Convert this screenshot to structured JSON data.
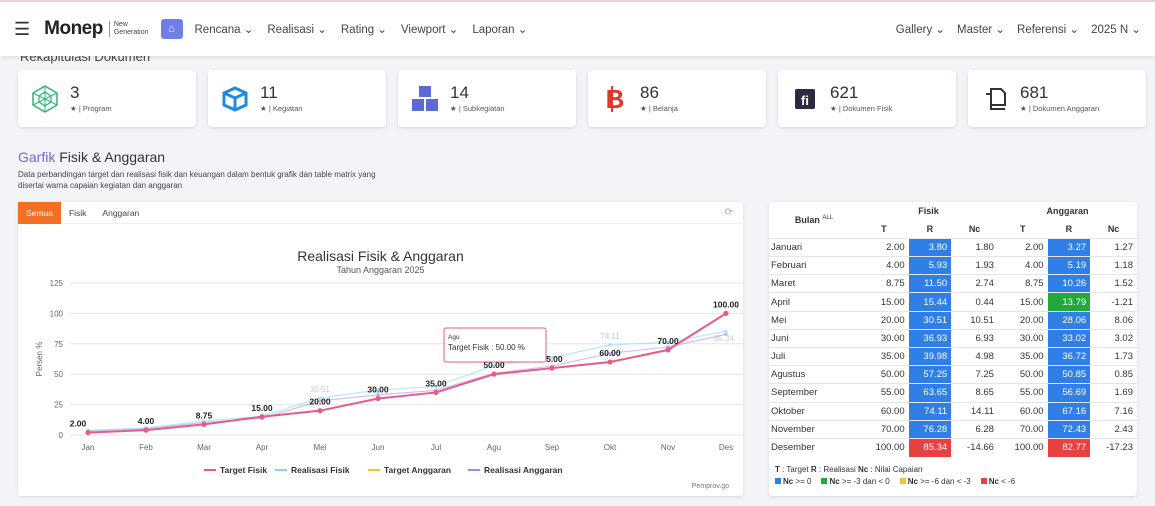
{
  "nav": {
    "logo": "Monep",
    "logo_sub_1": "New",
    "logo_sub_2": "Generation",
    "menu": [
      "Rencana ⌄",
      "Realisasi ⌄",
      "Rating ⌄",
      "Viewport ⌄",
      "Laporan ⌄"
    ],
    "right": [
      "Gallery ⌄",
      "Master ⌄",
      "Referensi ⌄",
      "2025 N ⌄"
    ]
  },
  "hidden_title": "Rekapitulasi Dokumen",
  "cards": [
    {
      "icon": "hexagon-network-icon",
      "value": "3",
      "label": "| Program"
    },
    {
      "icon": "cube-icon",
      "value": "11",
      "label": "| Kegiatan"
    },
    {
      "icon": "cubes-icon",
      "value": "14",
      "label": "| Subkegiatan"
    },
    {
      "icon": "bitcoin-icon",
      "value": "86",
      "label": "| Belanja"
    },
    {
      "icon": "fi-document-icon",
      "value": "621",
      "label": "| Dokumen Fisik"
    },
    {
      "icon": "copy-document-icon",
      "value": "681",
      "label": "| Dokumen Anggaran"
    }
  ],
  "section": {
    "title_colored": "Garfik",
    "title_rest": " Fisik & Anggaran",
    "desc": "Data perbandingan target dan realisasi fisik dan keuangan dalam bentuk grafik dan table matrix yang disertai warna capaian kegiatan dan anggaran"
  },
  "tabs": [
    "Semua",
    "Fisik",
    "Anggaran"
  ],
  "credit": "Pemprov.go",
  "tooltip": {
    "title": "Agu",
    "text": "Target Fisik : 50.00 %"
  },
  "colors": {
    "target_fisik": "#e85a8a",
    "realisasi_fisik": "#7fd8ec",
    "target_anggaran": "#f2c23b",
    "realisasi_anggaran": "#a98ae8",
    "blue": "#2f7fe6",
    "green": "#22a83b",
    "yellow": "#f2c23b",
    "red": "#e84141"
  },
  "chart_data": {
    "type": "line",
    "title": "Realisasi Fisik & Anggaran",
    "subtitle": "Tahun Anggaran 2025",
    "ylabel": "Persen %",
    "ylim": [
      0,
      125
    ],
    "yticks": [
      0,
      25,
      50,
      75,
      100,
      125
    ],
    "categories": [
      "Jan",
      "Feb",
      "Mar",
      "Apr",
      "Mei",
      "Jun",
      "Jul",
      "Agu",
      "Sep",
      "Okt",
      "Nov",
      "Des"
    ],
    "series": [
      {
        "name": "Target Fisik",
        "values": [
          2.0,
          4.0,
          8.75,
          15.0,
          20.0,
          30.0,
          35.0,
          50.0,
          55.0,
          60.0,
          70.0,
          100.0
        ]
      },
      {
        "name": "Realisasi Fisik",
        "values": [
          3.8,
          5.93,
          11.5,
          15.44,
          30.51,
          36.93,
          39.98,
          57.25,
          63.65,
          74.11,
          76.28,
          85.34
        ]
      },
      {
        "name": "Target Anggaran",
        "values": [
          2.0,
          4.0,
          8.75,
          15.0,
          20.0,
          30.0,
          35.0,
          50.0,
          55.0,
          60.0,
          70.0,
          100.0
        ]
      },
      {
        "name": "Realisasi Anggaran",
        "values": [
          3.27,
          5.19,
          10.26,
          13.79,
          28.06,
          33.02,
          36.72,
          50.85,
          56.69,
          67.16,
          72.43,
          82.77
        ]
      }
    ],
    "shown_labels": {
      "target_fisik": [
        "2.00",
        "4.00",
        "8.75",
        "15.00",
        "20.00",
        "30.00",
        "35.00",
        "50.00",
        "55.00",
        "60.00",
        "70.00",
        "100.00"
      ],
      "realisasi_faded": [
        {
          "i": 4,
          "t": "30.51"
        },
        {
          "i": 9,
          "t": "74.11"
        },
        {
          "i": 11,
          "t": "85.34"
        }
      ]
    }
  },
  "table": {
    "bulan": "Bulan",
    "all": "ALL",
    "fisik": "Fisik",
    "anggaran": "Anggaran",
    "cols": [
      "T",
      "R",
      "Nc",
      "T",
      "R",
      "Nc"
    ],
    "rows": [
      [
        "Januari",
        "2.00",
        "3.80",
        "1.80",
        "2.00",
        "3.27",
        "1.27",
        "b"
      ],
      [
        "Februari",
        "4.00",
        "5.93",
        "1.93",
        "4.00",
        "5.19",
        "1.18",
        "b"
      ],
      [
        "Maret",
        "8.75",
        "11.50",
        "2.74",
        "8.75",
        "10.26",
        "1.52",
        "b"
      ],
      [
        "April",
        "15.00",
        "15.44",
        "0.44",
        "15.00",
        "13.79",
        "-1.21",
        "g"
      ],
      [
        "Mei",
        "20.00",
        "30.51",
        "10.51",
        "20.00",
        "28.06",
        "8.06",
        "b"
      ],
      [
        "Juni",
        "30.00",
        "36.93",
        "6.93",
        "30.00",
        "33.02",
        "3.02",
        "b"
      ],
      [
        "Juli",
        "35.00",
        "39.98",
        "4.98",
        "35.00",
        "36.72",
        "1.73",
        "b"
      ],
      [
        "Agustus",
        "50.00",
        "57.25",
        "7.25",
        "50.00",
        "50.85",
        "0.85",
        "b"
      ],
      [
        "September",
        "55.00",
        "63.65",
        "8.65",
        "55.00",
        "56.69",
        "1.69",
        "b"
      ],
      [
        "Oktober",
        "60.00",
        "74.11",
        "14.11",
        "60.00",
        "67.16",
        "7.16",
        "b"
      ],
      [
        "November",
        "70.00",
        "76.28",
        "6.28",
        "70.00",
        "72.43",
        "2.43",
        "b"
      ],
      [
        "Desember",
        "100.00",
        "85.34",
        "-14.66",
        "100.00",
        "82.77",
        "-17.23",
        "r"
      ]
    ],
    "legend1": [
      "T",
      "  : Target   ",
      "R",
      " : Realisasi   ",
      "Nc",
      " : Nilai Capaian"
    ],
    "legend2": [
      {
        "t": "Nc",
        ">": " >= 0"
      },
      {
        "t": "Nc",
        ">": " >= -3 dan < 0"
      },
      {
        "t": "Nc",
        ">": " >= -6 dan < -3"
      },
      {
        "t": "Nc",
        ">": " < -6"
      }
    ]
  }
}
